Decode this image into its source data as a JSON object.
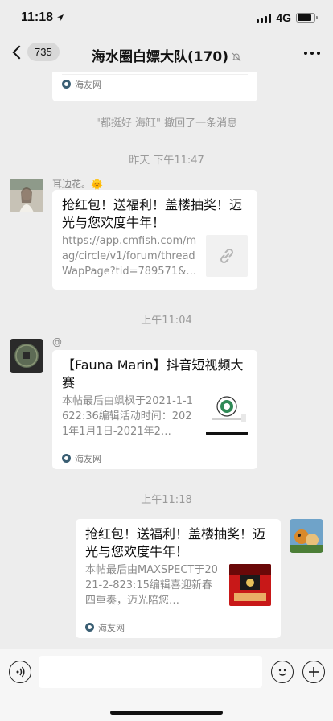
{
  "status": {
    "time": "11:18",
    "network": "4G",
    "battery_pct": 0.85
  },
  "nav": {
    "back_badge": "735",
    "title": "海水圈白嫖大队(170)"
  },
  "chat": {
    "top_card_source": "海友网",
    "recall_notice": "\"都挺好 海缸\" 撤回了一条消息",
    "time1": "昨天 下午11:47",
    "msg1": {
      "sender": "耳边花。🌞",
      "title": "抢红包！送福利！盖楼抽奖！迈光与您欢度牛年！",
      "desc": "https://app.cmfish.com/mag/circle/v1/forum/threadWapPage?tid=789571&…"
    },
    "time2": "上午11:04",
    "msg2": {
      "sender": "@",
      "title": "【Fauna Marin】抖音短视频大赛",
      "desc": "本帖最后由飒枫于2021-1-1622:36编辑活动时间：2021年1月1日-2021年2…",
      "source": "海友网"
    },
    "time3": "上午11:18",
    "msg3": {
      "title": "抢红包！送福利！盖楼抽奖！迈光与您欢度牛年！",
      "desc": "本帖最后由MAXSPECT于2021-2-823:15编辑喜迎新春四重奏，迈光陪您…",
      "source": "海友网"
    }
  },
  "icons": {
    "location": "location-arrow-icon",
    "mute": "mute-bell-icon",
    "more": "more-dots-icon",
    "voice": "voice-icon",
    "emoji": "emoji-icon",
    "plus": "plus-icon",
    "link": "link-icon"
  }
}
